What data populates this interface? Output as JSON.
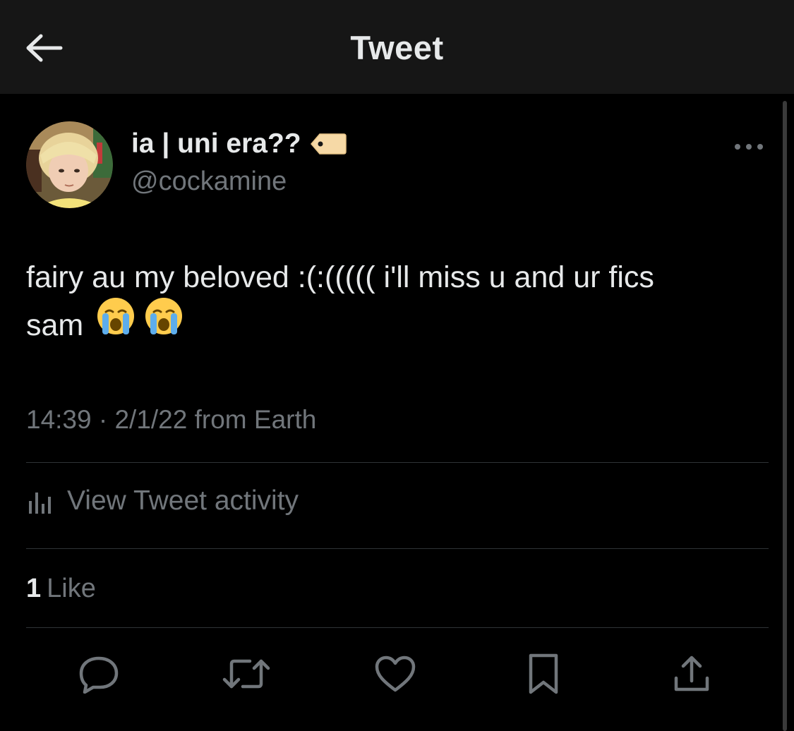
{
  "header": {
    "title": "Tweet",
    "back_icon": "arrow-left-icon"
  },
  "author": {
    "display_name": "ia | uni era??",
    "name_emoji": "label-tag-emoji",
    "username": "@cockamine"
  },
  "tweet": {
    "text_line1": "fairy au my beloved :(:((((( i'll miss u and ur fics",
    "text_line2": "sam",
    "emojis": [
      "loudly-crying-face-emoji",
      "loudly-crying-face-emoji"
    ],
    "meta": "14:39 · 2/1/22 from Earth"
  },
  "activity": {
    "label": "View Tweet activity",
    "icon": "bar-chart-icon"
  },
  "likes": {
    "count": "1",
    "label": "Like"
  },
  "actions": [
    "reply-icon",
    "retweet-icon",
    "like-icon",
    "bookmark-icon",
    "share-icon"
  ],
  "colors": {
    "background": "#000000",
    "header_background": "#161616",
    "primary_text": "#e7e9ea",
    "secondary_text": "#71767b",
    "divider": "#2f3336"
  }
}
